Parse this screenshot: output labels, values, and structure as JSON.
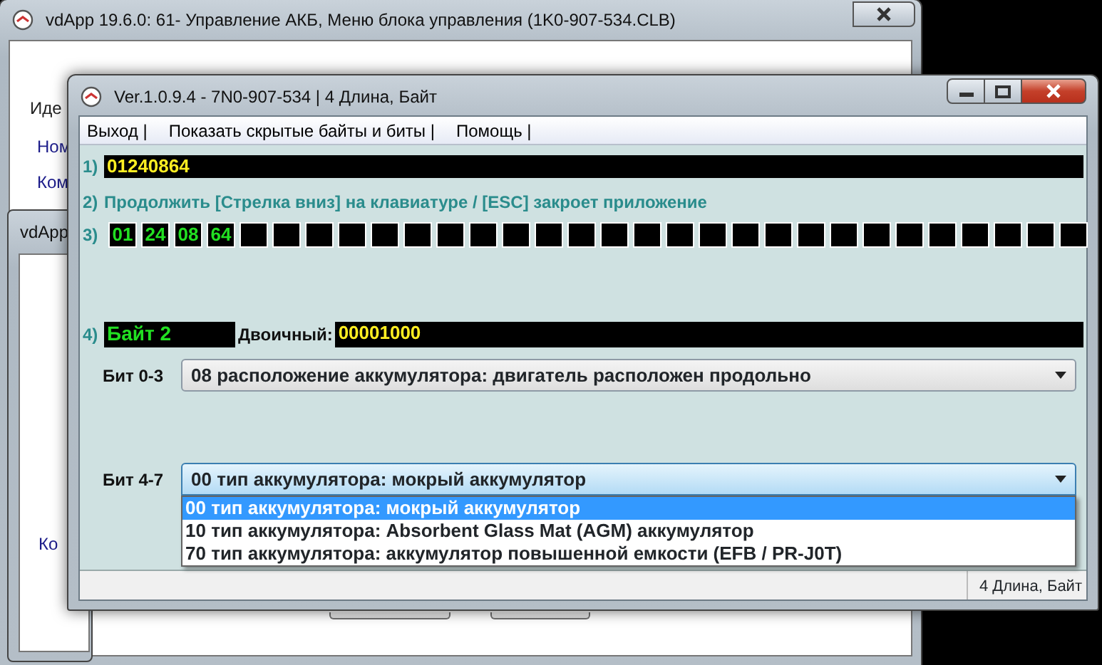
{
  "background_window": {
    "title": "vdApp 19.6.0: 61- Управление АКБ,  Меню блока управления (1K0-907-534.CLB)",
    "labels": [
      "Иде",
      "Ном",
      "Ком"
    ],
    "inner_window": {
      "title": "vdApp",
      "label": "Ко"
    }
  },
  "main_window": {
    "title": "Ver.1.0.9.4 -    7N0-907-534 | 4 Длина, Байт",
    "menu": [
      "Выход |",
      "Показать скрытые байты и биты |",
      "Помощь |"
    ],
    "raw_value": {
      "index": "1)",
      "value": "01240864"
    },
    "hint": {
      "index": "2)",
      "text": "Продолжить [Стрелка вниз] на клавиатуре / [ESC] закроет приложение"
    },
    "bytes": {
      "index": "3)",
      "values": [
        "01",
        "24",
        "08",
        "64"
      ]
    },
    "byte": {
      "index": "4)",
      "name": "Байт 2",
      "binary_label": "Двоичный:",
      "binary_value": "00001000"
    },
    "bit_fields": [
      {
        "label": "Бит 0-3",
        "value": "08 расположение аккумулятора: двигатель расположен продольно",
        "focused": false,
        "expanded": false
      },
      {
        "label": "Бит 4-7",
        "value": "00 тип аккумулятора: мокрый аккумулятор",
        "focused": true,
        "expanded": true,
        "options": [
          {
            "text": "00 тип аккумулятора: мокрый аккумулятор",
            "selected": true
          },
          {
            "text": "10 тип аккумулятора: Absorbent Glass Mat (AGM) аккумулятор",
            "selected": false
          },
          {
            "text": "70 тип аккумулятора: аккумулятор повышенной емкости (EFB / PR-J0T)",
            "selected": false
          }
        ]
      }
    ],
    "status_bar": "4 Длина, Байт"
  }
}
